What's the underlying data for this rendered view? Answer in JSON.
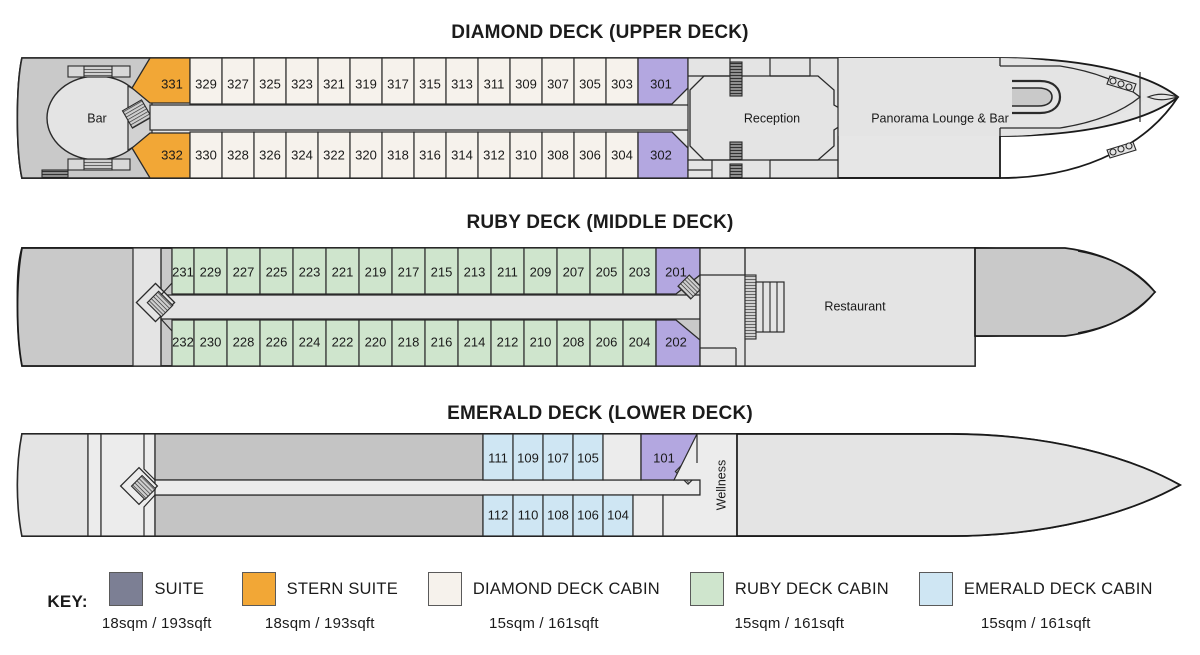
{
  "decks": [
    {
      "id": "diamond",
      "title": "DIAMOND DECK (UPPER DECK)",
      "rooms": [
        {
          "name": "Bar"
        },
        {
          "name": "Reception"
        },
        {
          "name": "Panorama Lounge & Bar"
        }
      ],
      "stern_suites": [
        "331",
        "332"
      ],
      "suites": [
        "301",
        "302"
      ],
      "cabins_upper": [
        "329",
        "327",
        "325",
        "323",
        "321",
        "319",
        "317",
        "315",
        "313",
        "311",
        "309",
        "307",
        "305",
        "303"
      ],
      "cabins_lower": [
        "330",
        "328",
        "326",
        "324",
        "322",
        "320",
        "318",
        "316",
        "314",
        "312",
        "310",
        "308",
        "306",
        "304"
      ]
    },
    {
      "id": "ruby",
      "title": "RUBY DECK (MIDDLE DECK)",
      "rooms": [
        {
          "name": "Restaurant"
        }
      ],
      "suites": [
        "201",
        "202"
      ],
      "cabins_upper": [
        "231",
        "229",
        "227",
        "225",
        "223",
        "221",
        "219",
        "217",
        "215",
        "213",
        "211",
        "209",
        "207",
        "205",
        "203"
      ],
      "cabins_lower": [
        "232",
        "230",
        "228",
        "226",
        "224",
        "222",
        "220",
        "218",
        "216",
        "214",
        "212",
        "210",
        "208",
        "206",
        "204"
      ]
    },
    {
      "id": "emerald",
      "title": "EMERALD DECK (LOWER DECK)",
      "rooms": [
        {
          "name": "Wellness"
        }
      ],
      "suites": [
        "101"
      ],
      "cabins_upper": [
        "111",
        "109",
        "107",
        "105"
      ],
      "cabins_lower": [
        "112",
        "110",
        "108",
        "106",
        "104"
      ]
    }
  ],
  "legend": {
    "key_label": "KEY:",
    "items": [
      {
        "label": "SUITE",
        "size": "18sqm / 193sqft",
        "color": "#7c7f94"
      },
      {
        "label": "STERN SUITE",
        "size": "18sqm / 193sqft",
        "color": "#f2a736"
      },
      {
        "label": "DIAMOND DECK CABIN",
        "size": "15sqm / 161sqft",
        "color": "#f6f2ec"
      },
      {
        "label": "RUBY DECK CABIN",
        "size": "15sqm / 161sqft",
        "color": "#cfe5cd"
      },
      {
        "label": "EMERALD DECK CABIN",
        "size": "15sqm / 161sqft",
        "color": "#cfe6f3"
      }
    ]
  },
  "colors": {
    "suite": "#b3a7e0",
    "stern_suite": "#f2a736",
    "diamond_cabin": "#f6f2ec",
    "ruby_cabin": "#cfe5cd",
    "emerald_cabin": "#cfe6f3",
    "hull_light": "#e6e6e6",
    "hull_mid": "#cfcfcf",
    "hull_dark": "#bfbfbf",
    "outline": "#1a1a1a"
  }
}
